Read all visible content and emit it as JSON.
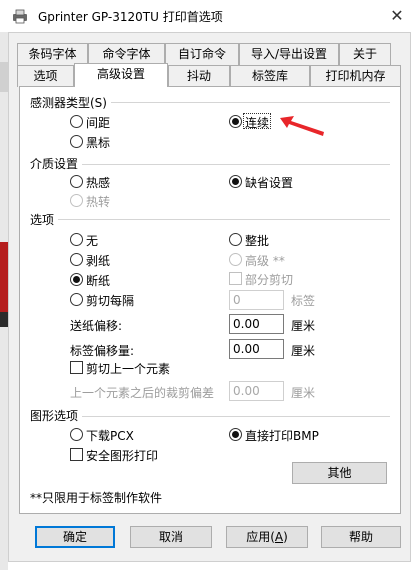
{
  "window": {
    "title": "Gprinter   GP-3120TU 打印首选项",
    "close_glyph": "✕"
  },
  "tabs_back": [
    "条码字体",
    "命令字体",
    "自订命令",
    "导入/导出设置",
    "关于"
  ],
  "tabs_front": [
    "选项",
    "高级设置",
    "抖动",
    "标签库",
    "打印机内存"
  ],
  "sensor": {
    "title": "感测器类型(S)",
    "gap": "间距",
    "continuous": "连续",
    "black_mark": "黑标",
    "selected": "continuous"
  },
  "media": {
    "title": "介质设置",
    "thermal": "热感",
    "thermal_transfer": "热转",
    "default": "缺省设置",
    "selected": "default"
  },
  "options": {
    "title": "选项",
    "none": "无",
    "batch": "整批",
    "peel": "剥纸",
    "advanced": "高级 **",
    "tear": "断纸",
    "partial_cut": "部分剪切",
    "cut_every": "剪切每隔",
    "cut_every_value": "0",
    "labels_unit": "标签",
    "feed_offset_label": "送纸偏移:",
    "feed_offset_value": "0.00",
    "feed_offset_unit": "厘米",
    "label_offset_label": "标签偏移量:",
    "label_offset_value": "0.00",
    "label_offset_unit": "厘米",
    "cut_prev_label": "剪切上一个元素",
    "after_prev_label": "上一个元素之后的裁剪偏差",
    "after_prev_value": "0.00",
    "after_prev_unit": "厘米",
    "selected": "tear"
  },
  "graphics": {
    "title": "图形选项",
    "download_pcx": "下载PCX",
    "direct_bmp": "直接打印BMP",
    "safe_graphics": "安全图形打印",
    "other_button": "其他",
    "selected": "direct_bmp"
  },
  "footnote": "**只限用于标签制作软件",
  "buttons": {
    "ok": "确定",
    "cancel": "取消",
    "apply_prefix": "应用(",
    "apply_key": "A",
    "apply_suffix": ")",
    "help": "帮助"
  },
  "colors": {
    "accent": "#0078d7",
    "arrow": "#e8262a",
    "disabled": "#9d9d9d"
  }
}
